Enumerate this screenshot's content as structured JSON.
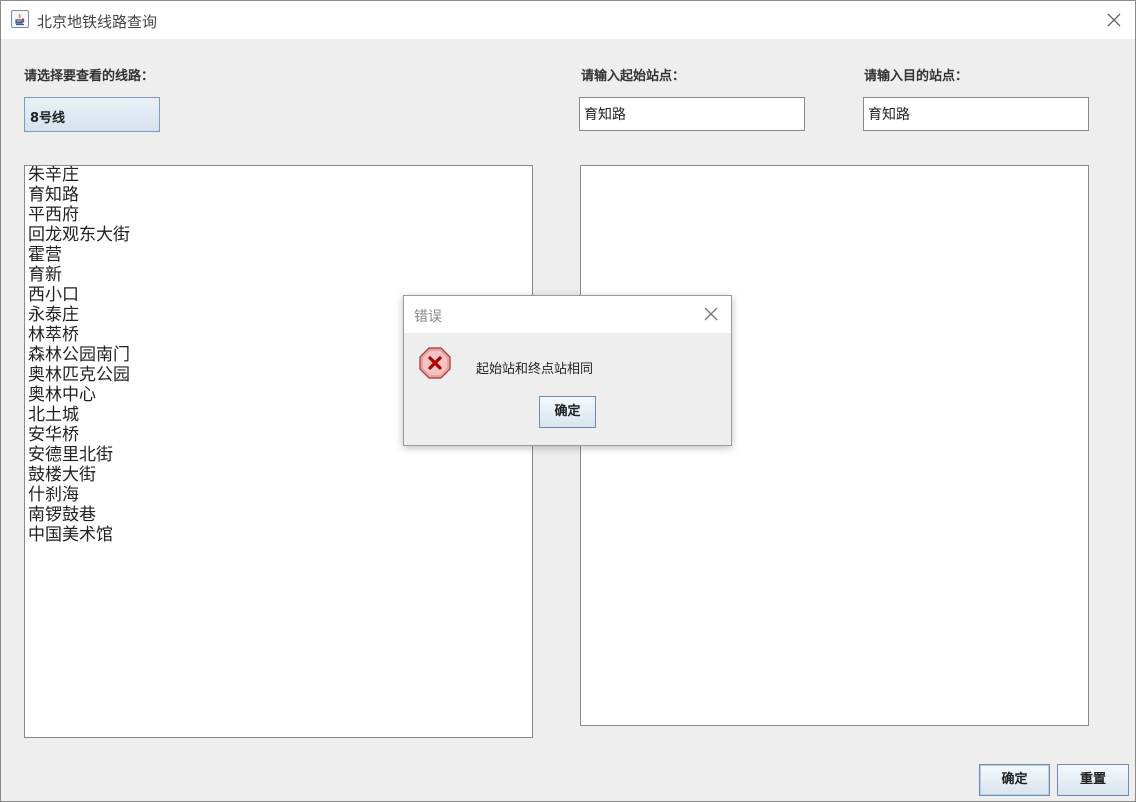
{
  "window": {
    "title": "北京地铁线路查询"
  },
  "line_selector": {
    "label": "请选择要查看的线路：",
    "selected": "8号线"
  },
  "start_station": {
    "label": "请输入起始站点：",
    "value": "育知路"
  },
  "end_station": {
    "label": "请输入目的站点：",
    "value": "育知路"
  },
  "station_list": [
    "朱辛庄",
    "育知路",
    "平西府",
    "回龙观东大街",
    "霍营",
    "育新",
    "西小口",
    "永泰庄",
    "林萃桥",
    "森林公园南门",
    "奥林匹克公园",
    "奥林中心",
    "北土城",
    "安华桥",
    "安德里北街",
    "鼓楼大街",
    "什刹海",
    "南锣鼓巷",
    "中国美术馆"
  ],
  "result": "",
  "buttons": {
    "confirm": "确定",
    "reset": "重置"
  },
  "dialog": {
    "title": "错误",
    "message": "起始站和终点站相同",
    "ok": "确定",
    "icon": "error-icon"
  }
}
